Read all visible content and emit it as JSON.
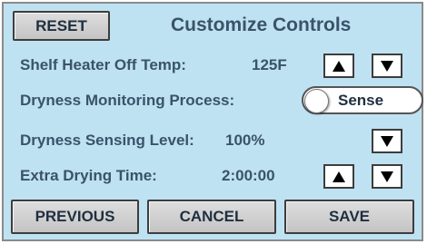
{
  "header": {
    "reset_label": "RESET",
    "title": "Customize Controls"
  },
  "settings": {
    "shelf_heater": {
      "label": "Shelf Heater Off Temp:",
      "value": "125F",
      "up_icon": "triangle-up-icon",
      "down_icon": "triangle-down-icon"
    },
    "dryness_monitoring": {
      "label": "Dryness Monitoring Process:",
      "toggle_text": "Sense",
      "toggle_state": "off"
    },
    "dryness_sensing": {
      "label": "Dryness Sensing Level:",
      "value": "100%",
      "down_icon": "triangle-down-icon"
    },
    "extra_drying": {
      "label": "Extra Drying Time:",
      "value": "2:00:00",
      "up_icon": "triangle-up-icon",
      "down_icon": "triangle-down-icon"
    }
  },
  "footer": {
    "previous_label": "PREVIOUS",
    "cancel_label": "CANCEL",
    "save_label": "SAVE"
  },
  "colors": {
    "panel_background": "#bfe2f2",
    "label_text": "#3a536a",
    "button_text": "#1e2f3f",
    "button_face": "#cfcfcf"
  }
}
